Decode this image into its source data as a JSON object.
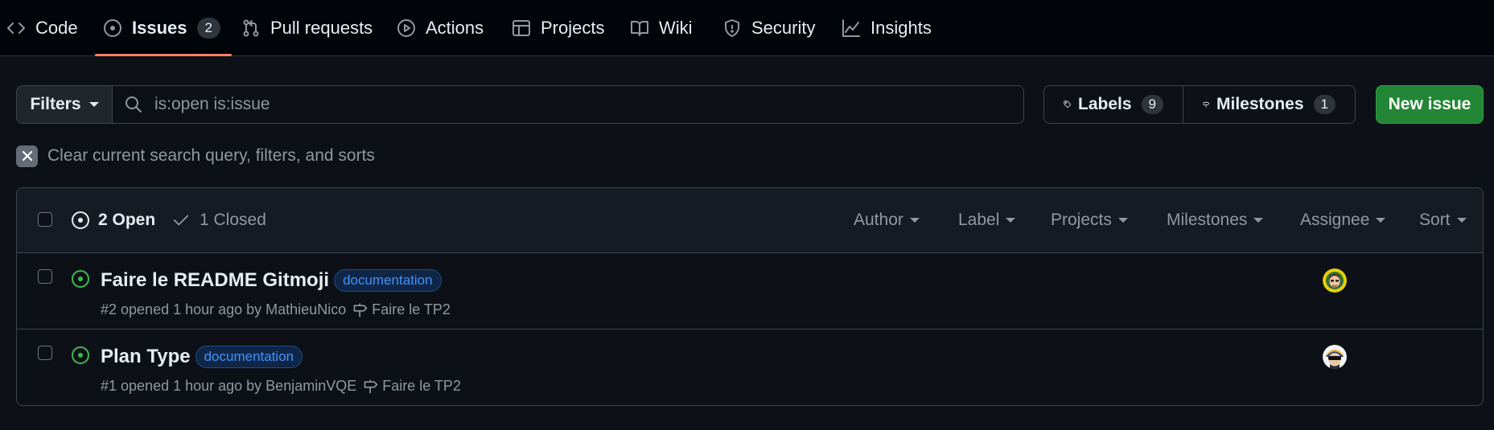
{
  "tabs": [
    {
      "label": "Code",
      "icon": "code-icon"
    },
    {
      "label": "Issues",
      "icon": "issue-opened-icon",
      "count": "2",
      "selected": true
    },
    {
      "label": "Pull requests",
      "icon": "git-pull-request-icon"
    },
    {
      "label": "Actions",
      "icon": "play-icon"
    },
    {
      "label": "Projects",
      "icon": "table-icon"
    },
    {
      "label": "Wiki",
      "icon": "book-icon"
    },
    {
      "label": "Security",
      "icon": "shield-icon"
    },
    {
      "label": "Insights",
      "icon": "graph-icon"
    }
  ],
  "filters": {
    "button_label": "Filters",
    "search_value": "is:open is:issue"
  },
  "labels_button": {
    "label": "Labels",
    "count": "9"
  },
  "milestones_button": {
    "label": "Milestones",
    "count": "1"
  },
  "new_issue_label": "New issue",
  "clear_query_text": "Clear current search query, filters, and sorts",
  "list_header": {
    "open_label": "2 Open",
    "closed_label": "1 Closed",
    "filters": [
      "Author",
      "Label",
      "Projects",
      "Milestones",
      "Assignee",
      "Sort"
    ]
  },
  "issues": [
    {
      "title": "Faire le README Gitmoji",
      "label": "documentation",
      "meta": "#2 opened 1 hour ago by MathieuNico",
      "milestone": "Faire le TP2",
      "state": "open"
    },
    {
      "title": "Plan Type",
      "label": "documentation",
      "meta": "#1 opened 1 hour ago by BenjaminVQE",
      "milestone": "Faire le TP2",
      "state": "open"
    }
  ],
  "colors": {
    "background": "#0d1117",
    "open_green": "#3fb950",
    "primary_button": "#238636",
    "selected_tab_underline": "#f78166",
    "label_blue": "#4493f8"
  }
}
